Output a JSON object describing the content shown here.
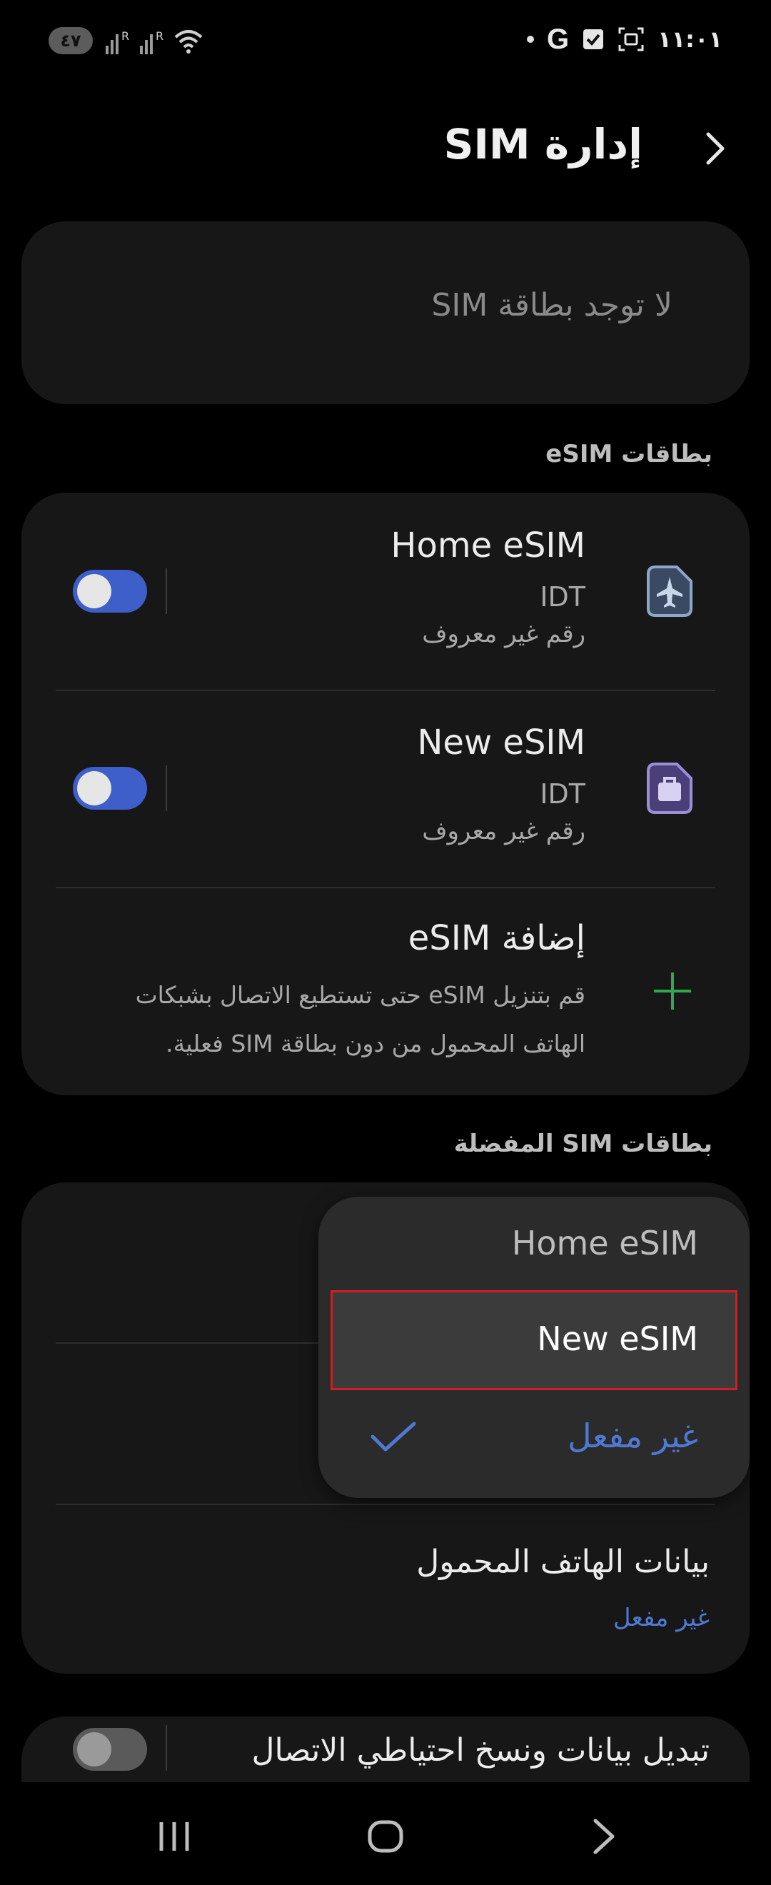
{
  "status_bar": {
    "time": "١١:٠١",
    "battery": "٤٧",
    "carrier_icon": "google-g-icon",
    "icons": [
      "signal-r-icon",
      "signal-r-icon",
      "wifi-icon",
      "dot-icon",
      "google-g-icon",
      "check-box-icon",
      "screenshot-icon"
    ]
  },
  "header": {
    "title": "إدارة SIM",
    "back_icon": "chevron-icon"
  },
  "sim_card": {
    "empty_text": "لا توجد بطاقة SIM"
  },
  "esim_section": {
    "label": "بطاقات eSIM",
    "items": [
      {
        "name": "Home eSIM",
        "carrier": "IDT",
        "number": "رقم غير معروف",
        "icon": "airplane-sim-icon",
        "enabled": true,
        "icon_color": "#8ea7c9"
      },
      {
        "name": "New eSIM",
        "carrier": "IDT",
        "number": "رقم غير معروف",
        "icon": "briefcase-sim-icon",
        "enabled": true,
        "icon_color": "#9b8fd6"
      }
    ],
    "add": {
      "title": "إضافة eSIM",
      "description": "قم بتنزيل eSIM حتى تستطيع الاتصال بشبكات الهاتف المحمول من دون بطاقة SIM فعلية.",
      "icon": "plus-icon"
    }
  },
  "preferred_section": {
    "label": "بطاقات SIM المفضلة",
    "mobile_data": {
      "title": "بيانات الهاتف المحمول",
      "value": "غير مفعل"
    }
  },
  "dropdown": {
    "options": [
      {
        "label": "Home eSIM",
        "state": "normal"
      },
      {
        "label": "New eSIM",
        "state": "highlighted"
      },
      {
        "label": "غير مفعل",
        "state": "checked"
      }
    ]
  },
  "partial_card": {
    "title": "تبديل بيانات ونسخ احتياطي الاتصال"
  },
  "nav_bar": {
    "recent": "recent-apps-icon",
    "home": "home-icon",
    "back": "back-icon"
  },
  "colors": {
    "accent": "#4f79d2",
    "toggle_on": "#3e5ec9",
    "add_plus": "#2fa84f",
    "highlight_outline": "#d01e24"
  }
}
